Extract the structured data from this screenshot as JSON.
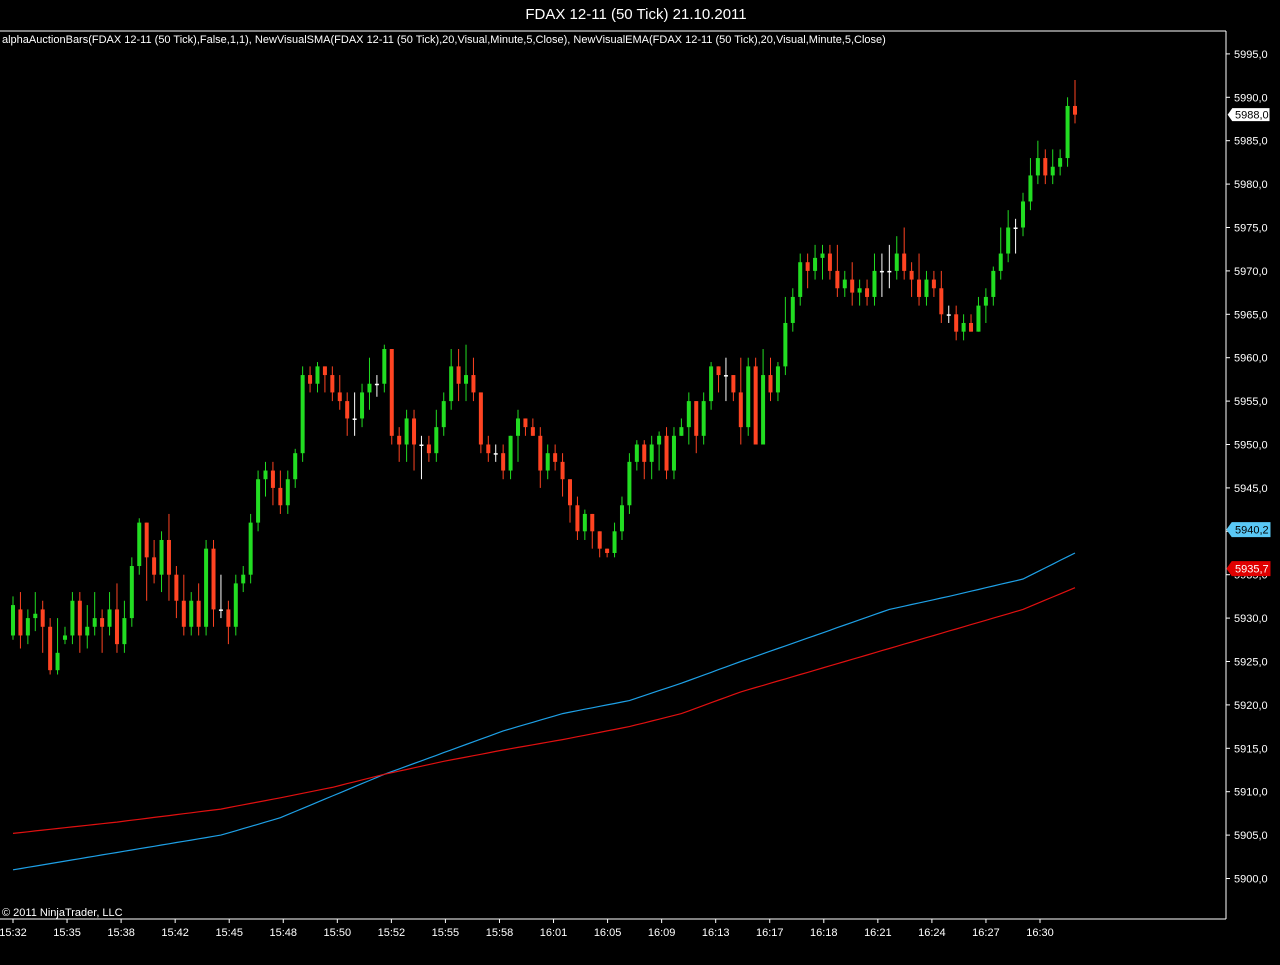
{
  "window": {
    "title": "FDAX 12-11 (50 Tick)  21.10.2011",
    "indicator_text": "alphaAuctionBars(FDAX 12-11 (50 Tick),False,1,1), NewVisualSMA(FDAX 12-11 (50 Tick),20,Visual,Minute,5,Close), NewVisualEMA(FDAX 12-11 (50 Tick),20,Visual,Minute,5,Close)",
    "copyright": "© 2011 NinjaTrader, LLC"
  },
  "colors": {
    "background": "#000000",
    "frame": "#ffffff",
    "up": "#22dd22",
    "down": "#ff4422",
    "doji": "#ffffff",
    "sma": "#1ea0e6",
    "ema": "#e01010",
    "sma_tag_bg": "#5ac8f5",
    "ema_tag_bg": "#e00000",
    "last_tag_bg": "#ffffff"
  },
  "chart_data": {
    "type": "candlestick",
    "instrument": "FDAX 12-11",
    "ylim": [
      5895,
      5997
    ],
    "yticks": [
      5900,
      5905,
      5910,
      5915,
      5920,
      5925,
      5930,
      5935,
      5940,
      5945,
      5950,
      5955,
      5960,
      5965,
      5970,
      5975,
      5980,
      5985,
      5990,
      5995
    ],
    "ytick_labels": [
      "5900,0",
      "5905,0",
      "5910,0",
      "5915,0",
      "5920,0",
      "5925,0",
      "5930,0",
      "5935,0",
      "5940,0",
      "5945,0",
      "5950,0",
      "5955,0",
      "5960,0",
      "5965,0",
      "5970,0",
      "5975,0",
      "5980,0",
      "5985,0",
      "5990,0",
      "5995,0"
    ],
    "time_labels": [
      "15:32",
      "15:35",
      "15:38",
      "15:42",
      "15:45",
      "15:48",
      "15:50",
      "15:52",
      "15:55",
      "15:58",
      "16:01",
      "16:05",
      "16:09",
      "16:13",
      "16:17",
      "16:18",
      "16:21",
      "16:24",
      "16:27",
      "16:30"
    ],
    "candles": [
      [
        5928,
        5931.5,
        5932.5,
        5927.5
      ],
      [
        5931,
        5928,
        5933,
        5926.5
      ],
      [
        5928,
        5930,
        5931,
        5927
      ],
      [
        5930,
        5930.5,
        5933,
        5928.5
      ],
      [
        5931,
        5929,
        5932,
        5926
      ],
      [
        5929,
        5924,
        5930,
        5923.5
      ],
      [
        5924,
        5926,
        5930,
        5923.5
      ],
      [
        5927.5,
        5928,
        5929,
        5927
      ],
      [
        5928,
        5932,
        5933,
        5927
      ],
      [
        5932,
        5928,
        5933,
        5926
      ],
      [
        5928,
        5929,
        5931.5,
        5926.5
      ],
      [
        5929,
        5930,
        5933,
        5928
      ],
      [
        5930,
        5929,
        5931,
        5926
      ],
      [
        5929,
        5931,
        5933,
        5928
      ],
      [
        5931,
        5927,
        5934,
        5926
      ],
      [
        5927,
        5930,
        5932,
        5926
      ],
      [
        5930,
        5936,
        5937,
        5929
      ],
      [
        5936,
        5941,
        5941.5,
        5935
      ],
      [
        5941,
        5937,
        5941,
        5932
      ],
      [
        5937,
        5935,
        5939,
        5934
      ],
      [
        5935,
        5939,
        5940,
        5933
      ],
      [
        5939,
        5935,
        5942,
        5932
      ],
      [
        5935,
        5932,
        5936,
        5930
      ],
      [
        5932,
        5929,
        5935,
        5928
      ],
      [
        5929,
        5932,
        5933,
        5928
      ],
      [
        5932,
        5929,
        5934,
        5928
      ],
      [
        5929,
        5938,
        5939,
        5928
      ],
      [
        5938,
        5931,
        5939,
        5929
      ],
      [
        5931,
        5931,
        5935,
        5930
      ],
      [
        5931,
        5929,
        5932,
        5927
      ],
      [
        5929,
        5934,
        5935,
        5928
      ],
      [
        5934,
        5935,
        5936,
        5933
      ],
      [
        5935,
        5941,
        5942,
        5934
      ],
      [
        5941,
        5946,
        5947,
        5940
      ],
      [
        5946,
        5947,
        5948,
        5944
      ],
      [
        5947,
        5945,
        5948,
        5943
      ],
      [
        5945,
        5943,
        5947,
        5942
      ],
      [
        5943,
        5946,
        5947,
        5942
      ],
      [
        5946,
        5949,
        5949.5,
        5945
      ],
      [
        5949,
        5958,
        5959,
        5948
      ],
      [
        5958,
        5957,
        5959,
        5956
      ],
      [
        5957,
        5959,
        5959.5,
        5956
      ],
      [
        5959,
        5958,
        5959,
        5956
      ],
      [
        5958,
        5956,
        5959,
        5955
      ],
      [
        5956,
        5955,
        5958,
        5954
      ],
      [
        5955,
        5953,
        5956,
        5951
      ],
      [
        5953,
        5953,
        5956,
        5951
      ],
      [
        5953,
        5956,
        5957,
        5952
      ],
      [
        5956,
        5957,
        5960,
        5954
      ],
      [
        5957,
        5957,
        5958,
        5955.5
      ],
      [
        5957,
        5961,
        5961.5,
        5956
      ],
      [
        5961,
        5951,
        5961,
        5950
      ],
      [
        5951,
        5950,
        5952,
        5948
      ],
      [
        5950,
        5953,
        5954,
        5948
      ],
      [
        5953,
        5950,
        5954,
        5947
      ],
      [
        5950,
        5950,
        5951,
        5946
      ],
      [
        5950,
        5949,
        5951,
        5948
      ],
      [
        5949,
        5952,
        5954,
        5948
      ],
      [
        5952,
        5955,
        5956,
        5951
      ],
      [
        5955,
        5959,
        5961,
        5954
      ],
      [
        5959,
        5957,
        5961,
        5955
      ],
      [
        5957,
        5958,
        5961.5,
        5955
      ],
      [
        5958,
        5956,
        5960,
        5955
      ],
      [
        5956,
        5950,
        5956,
        5949
      ],
      [
        5950,
        5949,
        5951,
        5948
      ],
      [
        5949,
        5949,
        5950,
        5948
      ],
      [
        5949,
        5947,
        5950,
        5946
      ],
      [
        5947,
        5951,
        5951,
        5946
      ],
      [
        5951,
        5953,
        5954,
        5948
      ],
      [
        5953,
        5952,
        5953,
        5951
      ],
      [
        5952,
        5951,
        5953,
        5951
      ],
      [
        5951,
        5947,
        5952,
        5945
      ],
      [
        5947,
        5949,
        5950,
        5946
      ],
      [
        5949,
        5948,
        5950,
        5947
      ],
      [
        5948,
        5946,
        5949,
        5944
      ],
      [
        5946,
        5943,
        5946,
        5941
      ],
      [
        5943,
        5940,
        5944,
        5939
      ],
      [
        5940,
        5942,
        5942.5,
        5939
      ],
      [
        5942,
        5940,
        5942,
        5938
      ],
      [
        5940,
        5938,
        5940,
        5937
      ],
      [
        5938,
        5937.5,
        5938,
        5937
      ],
      [
        5937.5,
        5940,
        5941,
        5937
      ],
      [
        5940,
        5943,
        5944,
        5939
      ],
      [
        5943,
        5948,
        5949,
        5942
      ],
      [
        5948,
        5950,
        5950.5,
        5947
      ],
      [
        5950,
        5948,
        5950.5,
        5946
      ],
      [
        5948,
        5950,
        5951,
        5946
      ],
      [
        5950,
        5951,
        5951.5,
        5947
      ],
      [
        5951,
        5947,
        5952,
        5946
      ],
      [
        5947,
        5951,
        5952,
        5946
      ],
      [
        5951,
        5952,
        5953,
        5951
      ],
      [
        5952,
        5955,
        5956,
        5950
      ],
      [
        5955,
        5951,
        5955,
        5949
      ],
      [
        5951,
        5955,
        5956,
        5950
      ],
      [
        5955,
        5959,
        5959.5,
        5954
      ],
      [
        5959,
        5958,
        5959,
        5956
      ],
      [
        5958,
        5958,
        5960,
        5955
      ],
      [
        5958,
        5956,
        5958,
        5955
      ],
      [
        5956,
        5952,
        5960,
        5950
      ],
      [
        5952,
        5959,
        5960,
        5951
      ],
      [
        5959,
        5950,
        5960,
        5950
      ],
      [
        5950,
        5958,
        5961,
        5957
      ],
      [
        5958,
        5956,
        5960,
        5955
      ],
      [
        5956,
        5959,
        5959.5,
        5955
      ],
      [
        5959,
        5964,
        5967,
        5958
      ],
      [
        5964,
        5967,
        5968,
        5963
      ],
      [
        5967,
        5971,
        5972,
        5966
      ],
      [
        5971,
        5970,
        5972,
        5968
      ],
      [
        5970,
        5971.5,
        5973,
        5969
      ],
      [
        5971.5,
        5972,
        5973,
        5969
      ],
      [
        5972,
        5970,
        5973,
        5969
      ],
      [
        5970,
        5968,
        5973,
        5967
      ],
      [
        5968,
        5969,
        5970,
        5967
      ],
      [
        5969,
        5967.5,
        5971,
        5966
      ],
      [
        5967.5,
        5968,
        5969,
        5966
      ],
      [
        5968,
        5967,
        5969,
        5966
      ],
      [
        5967,
        5970,
        5972,
        5966
      ],
      [
        5970,
        5970,
        5972,
        5967
      ],
      [
        5970,
        5970,
        5973,
        5968
      ],
      [
        5970,
        5972,
        5974,
        5969
      ],
      [
        5972,
        5970,
        5975,
        5969
      ],
      [
        5970,
        5969,
        5971,
        5967
      ],
      [
        5969,
        5967,
        5972,
        5966
      ],
      [
        5967,
        5969,
        5970,
        5966
      ],
      [
        5969,
        5968,
        5970,
        5967
      ],
      [
        5968,
        5965,
        5970,
        5964
      ],
      [
        5965,
        5965,
        5966,
        5964
      ],
      [
        5965,
        5963,
        5966,
        5962
      ],
      [
        5963,
        5964,
        5965,
        5962
      ],
      [
        5964,
        5963,
        5965,
        5963
      ],
      [
        5963,
        5966,
        5967,
        5963
      ],
      [
        5966,
        5967,
        5968,
        5964
      ],
      [
        5967,
        5970,
        5970.5,
        5966
      ],
      [
        5970,
        5972,
        5975,
        5969
      ],
      [
        5972,
        5975,
        5977,
        5971
      ],
      [
        5975,
        5975,
        5976,
        5972
      ],
      [
        5975,
        5978,
        5979,
        5974
      ],
      [
        5978,
        5981,
        5983,
        5977
      ],
      [
        5981,
        5983,
        5985,
        5980
      ],
      [
        5983,
        5981,
        5984,
        5980
      ],
      [
        5981,
        5982,
        5984,
        5980
      ],
      [
        5982,
        5983,
        5984,
        5981
      ],
      [
        5983,
        5989,
        5990,
        5982
      ],
      [
        5989,
        5988,
        5992,
        5987
      ]
    ],
    "series": [
      {
        "name": "NewVisualSMA",
        "start": 5901,
        "end": 5940.2,
        "waypoints": [
          [
            0,
            5901
          ],
          [
            14,
            5903
          ],
          [
            28,
            5905
          ],
          [
            36,
            5907
          ],
          [
            43,
            5909.5
          ],
          [
            50,
            5912
          ],
          [
            58,
            5914.5
          ],
          [
            66,
            5917
          ],
          [
            74,
            5919
          ],
          [
            83,
            5920.5
          ],
          [
            90,
            5922.5
          ],
          [
            98,
            5925
          ],
          [
            108,
            5928
          ],
          [
            118,
            5931
          ],
          [
            126,
            5932.5
          ],
          [
            136,
            5934.5
          ],
          [
            143,
            5937.5
          ],
          [
            148,
            5940.2
          ]
        ]
      },
      {
        "name": "NewVisualEMA",
        "start": 5905.2,
        "end": 5935.7,
        "waypoints": [
          [
            0,
            5905.2
          ],
          [
            14,
            5906.5
          ],
          [
            28,
            5908
          ],
          [
            36,
            5909.3
          ],
          [
            43,
            5910.5
          ],
          [
            50,
            5912
          ],
          [
            58,
            5913.5
          ],
          [
            66,
            5914.8
          ],
          [
            74,
            5916
          ],
          [
            83,
            5917.5
          ],
          [
            90,
            5919
          ],
          [
            98,
            5921.5
          ],
          [
            108,
            5924
          ],
          [
            118,
            5926.5
          ],
          [
            126,
            5928.5
          ],
          [
            136,
            5931
          ],
          [
            143,
            5933.5
          ],
          [
            148,
            5935.7
          ]
        ]
      }
    ],
    "last_price": 5988.0,
    "last_price_label": "5988,0",
    "sma_label": "5940,2",
    "ema_label": "5935,7"
  }
}
